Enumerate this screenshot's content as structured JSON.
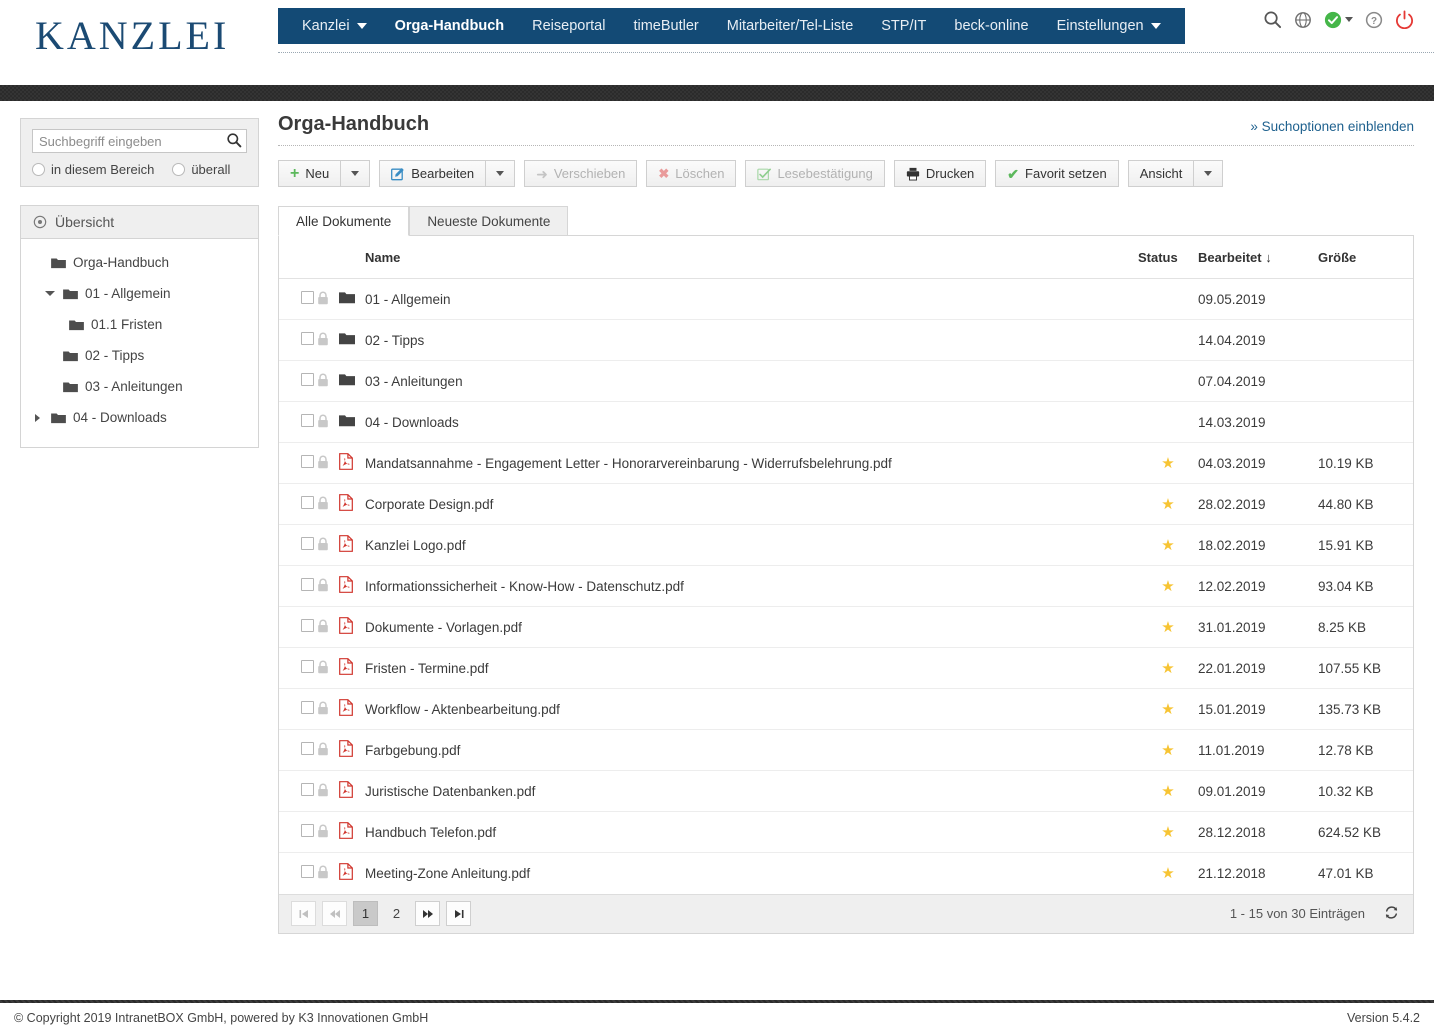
{
  "brand": {
    "logo_text": "KANZLEI",
    "accent_color": "#134a75"
  },
  "nav": {
    "items": [
      {
        "label": "Kanzlei",
        "has_caret": true,
        "active": false
      },
      {
        "label": "Orga-Handbuch",
        "has_caret": false,
        "active": true
      },
      {
        "label": "Reiseportal",
        "has_caret": false,
        "active": false
      },
      {
        "label": "timeButler",
        "has_caret": false,
        "active": false
      },
      {
        "label": "Mitarbeiter/Tel-Liste",
        "has_caret": false,
        "active": false
      },
      {
        "label": "STP/IT",
        "has_caret": false,
        "active": false
      },
      {
        "label": "beck-online",
        "has_caret": false,
        "active": false
      },
      {
        "label": "Einstellungen",
        "has_caret": true,
        "active": false
      }
    ],
    "icons": [
      {
        "name": "search-icon",
        "color": "#555"
      },
      {
        "name": "globe-icon",
        "color": "#707070"
      },
      {
        "name": "status-check-icon",
        "color": "#4caf50"
      },
      {
        "name": "help-icon",
        "color": "#8a8a8a"
      },
      {
        "name": "power-icon",
        "color": "#e53935"
      }
    ]
  },
  "sidebar": {
    "search": {
      "placeholder": "Suchbegriff eingeben",
      "value": "",
      "options": [
        {
          "label": "in diesem Bereich",
          "selected": false
        },
        {
          "label": "überall",
          "selected": false
        }
      ]
    },
    "tree": {
      "header": "Übersicht",
      "nodes": [
        {
          "label": "Orga-Handbuch",
          "indent": 0,
          "toggle": "none"
        },
        {
          "label": "01 - Allgemein",
          "indent": 1,
          "toggle": "expanded"
        },
        {
          "label": "01.1 Fristen",
          "indent": 2,
          "toggle": "none"
        },
        {
          "label": "02 - Tipps",
          "indent": 1,
          "toggle": "none"
        },
        {
          "label": "03 - Anleitungen",
          "indent": 1,
          "toggle": "none"
        },
        {
          "label": "04 - Downloads",
          "indent": 1,
          "toggle": "collapsed"
        }
      ]
    }
  },
  "main": {
    "title": "Orga-Handbuch",
    "search_options_link": "» Suchoptionen einblenden",
    "toolbar": {
      "neu": "Neu",
      "bearbeiten": "Bearbeiten",
      "verschieben": "Verschieben",
      "loeschen": "Löschen",
      "lesebestaetigung": "Lesebestätigung",
      "drucken": "Drucken",
      "favorit": "Favorit setzen",
      "ansicht": "Ansicht"
    },
    "tabs": [
      {
        "label": "Alle Dokumente",
        "active": true
      },
      {
        "label": "Neueste Dokumente",
        "active": false
      }
    ],
    "table": {
      "columns": {
        "name": "Name",
        "status": "Status",
        "bearbeitet": "Bearbeitet ↓",
        "groesse": "Größe"
      },
      "rows": [
        {
          "type": "folder",
          "name": "01 - Allgemein",
          "locked": true,
          "favorite": false,
          "date": "09.05.2019",
          "size": ""
        },
        {
          "type": "folder",
          "name": "02 - Tipps",
          "locked": true,
          "favorite": false,
          "date": "14.04.2019",
          "size": ""
        },
        {
          "type": "folder",
          "name": "03 - Anleitungen",
          "locked": true,
          "favorite": false,
          "date": "07.04.2019",
          "size": ""
        },
        {
          "type": "folder",
          "name": "04 - Downloads",
          "locked": true,
          "favorite": false,
          "date": "14.03.2019",
          "size": ""
        },
        {
          "type": "pdf",
          "name": "Mandatsannahme - Engagement Letter - Honorarvereinbarung - Widerrufsbelehrung.pdf",
          "locked": true,
          "favorite": true,
          "date": "04.03.2019",
          "size": "10.19 KB"
        },
        {
          "type": "pdf",
          "name": "Corporate Design.pdf",
          "locked": true,
          "favorite": true,
          "date": "28.02.2019",
          "size": "44.80 KB"
        },
        {
          "type": "pdf",
          "name": "Kanzlei Logo.pdf",
          "locked": true,
          "favorite": true,
          "date": "18.02.2019",
          "size": "15.91 KB"
        },
        {
          "type": "pdf",
          "name": "Informationssicherheit - Know-How - Datenschutz.pdf",
          "locked": true,
          "favorite": true,
          "date": "12.02.2019",
          "size": "93.04 KB"
        },
        {
          "type": "pdf",
          "name": "Dokumente - Vorlagen.pdf",
          "locked": true,
          "favorite": true,
          "date": "31.01.2019",
          "size": "8.25 KB"
        },
        {
          "type": "pdf",
          "name": "Fristen - Termine.pdf",
          "locked": true,
          "favorite": true,
          "date": "22.01.2019",
          "size": "107.55 KB"
        },
        {
          "type": "pdf",
          "name": "Workflow - Aktenbearbeitung.pdf",
          "locked": true,
          "favorite": true,
          "date": "15.01.2019",
          "size": "135.73 KB"
        },
        {
          "type": "pdf",
          "name": "Farbgebung.pdf",
          "locked": true,
          "favorite": true,
          "date": "11.01.2019",
          "size": "12.78 KB"
        },
        {
          "type": "pdf",
          "name": "Juristische Datenbanken.pdf",
          "locked": true,
          "favorite": true,
          "date": "09.01.2019",
          "size": "10.32 KB"
        },
        {
          "type": "pdf",
          "name": "Handbuch Telefon.pdf",
          "locked": true,
          "favorite": true,
          "date": "28.12.2018",
          "size": "624.52 KB"
        },
        {
          "type": "pdf",
          "name": "Meeting-Zone Anleitung.pdf",
          "locked": true,
          "favorite": true,
          "date": "21.12.2018",
          "size": "47.01 KB"
        }
      ]
    },
    "pagination": {
      "first": "⏮",
      "prev": "⏪",
      "next": "⏩",
      "last": "⏭",
      "pages": [
        "1",
        "2"
      ],
      "current": "1",
      "info": "1 - 15 von 30 Einträgen"
    }
  },
  "footer": {
    "copyright": "© Copyright 2019 IntranetBOX GmbH, powered by K3 Innovationen GmbH",
    "version": "Version 5.4.2"
  }
}
